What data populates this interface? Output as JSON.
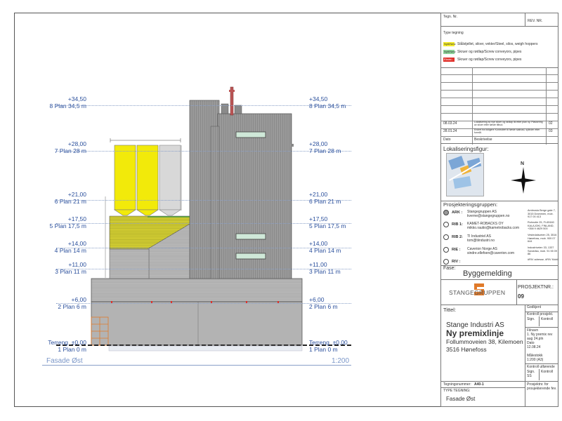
{
  "levels": [
    {
      "value": "+34,50",
      "label": "8 Plan 34,5 m"
    },
    {
      "value": "+28,00",
      "label": "7 Plan 28 m"
    },
    {
      "value": "+21,00",
      "label": "6 Plan 21 m"
    },
    {
      "value": "+17,50",
      "label": "5 Plan 17,5 m"
    },
    {
      "value": "+14,00",
      "label": "4 Plan 14 m"
    },
    {
      "value": "+11,00",
      "label": "3 Plan 11 m"
    },
    {
      "value": "+6,00",
      "label": "2 Plan 6 m"
    },
    {
      "value": "±0,00",
      "label": "1 Plan 0 m",
      "prefix": "Terreng"
    }
  ],
  "drawing": {
    "view_title": "Fasade Øst",
    "scale": "1:200"
  },
  "titleblock": {
    "tegn_nr": "Tegn. Nr.",
    "rev_nr": "REV. NR.",
    "type_tegning_label": "Type tegning",
    "legend": [
      {
        "tag": "Nytt/New:",
        "text": "Stålstjellet, siloer, vekter/Steel, silos, weigh hoppers",
        "color": "#f2ea2a"
      },
      {
        "tag": "Nytt/New:",
        "text": "Skruer og rødlap/Screw conveyors, pipes",
        "color": "#8fd39a"
      },
      {
        "tag": "Eksist.:",
        "text": "Skruer og rødlap/Screw conveyors, pipes",
        "color": "#e0302a"
      }
    ],
    "revisions": [
      {
        "date": "08.03.24",
        "text": "Lokalisering av nye siloer og rødlap lik etter plan ny. Plassering av siloer etter første tilbud.",
        "rev": "02"
      },
      {
        "date": "28.01.24",
        "text": "Endret fra tidligere Kontrollert til første søknad, sylinder etter formål.",
        "rev": "03"
      }
    ],
    "beskrivelse": "Beskrivelse",
    "dato": "Dato",
    "lokalisering_title": "Lokaliseringsfigur:",
    "north": "N",
    "prosjektering_title": "Prosjekteringsgruppen:",
    "roles": [
      {
        "role": "ARK :",
        "firm": "Stangegruppen AS",
        "email": "kverne@stangegruppen.no",
        "addr": "Ambrosia Berge gate 7, 3015 Drammen, mob. 917 00 413"
      },
      {
        "role": "RIB 1:",
        "firm": "KAMET-ROBACKS OY",
        "email": "mikko.rautio@kametrobacks.com",
        "addr": "Rohnotie 25, FI-65160 KALAJOKI, FINLAND, +358 9 4629 500"
      },
      {
        "role": "RIB 2:",
        "firm": "TI Industriel AS",
        "email": "tom@tiindustri.no",
        "addr": "Vestedalsveien 25, 3516 Hønefoss, mob. 909 07 644"
      },
      {
        "role": "RIE :",
        "firm": "Caverion Norge AS",
        "email": "sindre.ellefsen@caverion.com",
        "addr": "Industriveien 33, 1337 Sandvika, mob. 91 55 09 86"
      },
      {
        "role": "RIV :",
        "firm": "",
        "email": "",
        "addr": "#RIV adresse, #RIV Mobil"
      }
    ],
    "fase_label": "Fase:",
    "fase_value": "Byggemelding",
    "logo_text": "STANGEGRUPPEN",
    "prosjektnr_label": "PROSJEKTNR.:",
    "prosjektnr_value": "09",
    "tittel_label": "Tittel:",
    "title_line1": "Stange Industri AS",
    "title_line2": "Ny premixlinje",
    "title_line3": "Follummoveien 38, Kilemoen",
    "title_line4": "3516 Hønefoss",
    "godkjent": "Godkjent",
    "kontroll_prosjekt": "Kontroll prosjekt.",
    "sign": "Sign.",
    "kontroll": "Kontroll",
    "filnavn_label": "Filnavn",
    "filnavn_value": "1. Ny premix rev aug 24.pln",
    "dato_label": "Dato",
    "dato_value": "12.08.24",
    "malestokk_label": "Målestokk",
    "malestokk_value": "1:200 (A3)",
    "kontroll_utforende": "Kontroll utførende",
    "sign_ss": "SS",
    "tegningsnummer_label": "Tegningsnummer:",
    "tegningsnummer_value": "A40-1",
    "type_tegning_label2": "TYPE TEGNING:",
    "type_tegning_value": "Fasade Øst",
    "prosjektnr_footer": "Prosjektnr. for prosjekterende fev."
  }
}
